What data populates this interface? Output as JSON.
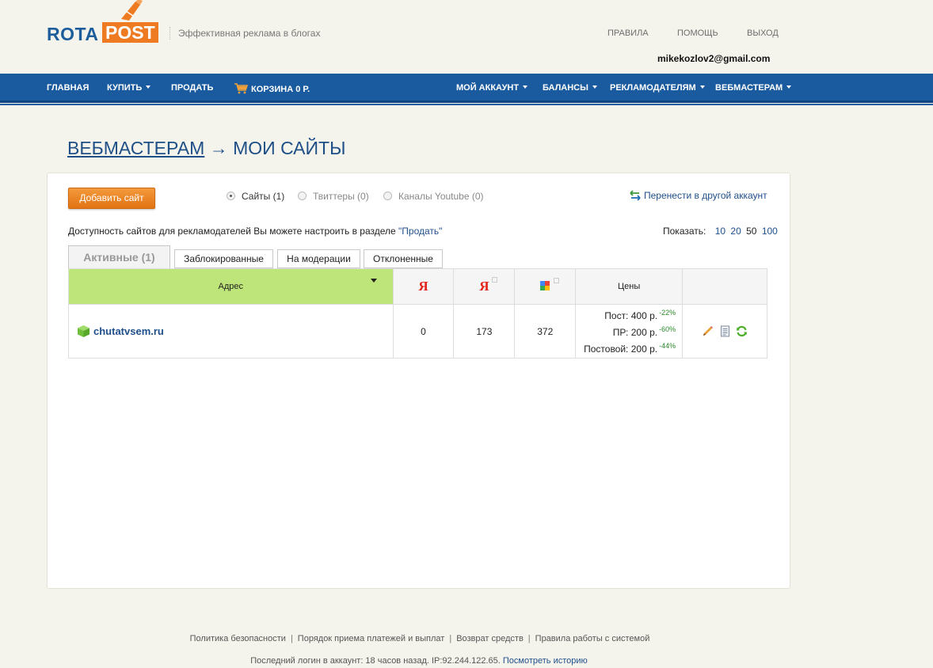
{
  "brand": {
    "part1": "ROTA",
    "part2": "POST",
    "tagline": "Эффективная реклама в блогах",
    "accent": "#ee7b22",
    "primary": "#1a5ba0"
  },
  "top_links": {
    "rules": "ПРАВИЛА",
    "help": "ПОМОЩЬ",
    "exit": "ВЫХОД"
  },
  "user": {
    "email": "mikekozlov2@gmail.com"
  },
  "nav": {
    "home": "ГЛАВНАЯ",
    "buy": "КУПИТЬ",
    "sell": "ПРОДАТЬ",
    "cart": "КОРЗИНА 0 Р.",
    "account": "МОЙ АККАУНТ",
    "balances": "БАЛАНСЫ",
    "advertisers": "РЕКЛАМОДАТЕЛЯМ",
    "webmasters": "ВЕБМАСТЕРАМ"
  },
  "breadcrumb": {
    "parent": "ВЕБМАСТЕРАМ",
    "arrow": "→",
    "current": "МОИ САЙТЫ"
  },
  "panel": {
    "add_button": "Добавить сайт",
    "radios": [
      {
        "label": "Сайты (1)",
        "checked": true
      },
      {
        "label": "Твиттеры (0)",
        "checked": false
      },
      {
        "label": "Каналы Youtube (0)",
        "checked": false
      }
    ],
    "transfer_link": "Перенести в другой аккаунт",
    "availability_text": "Доступность сайтов для рекламодателей Вы можете настроить в разделе",
    "availability_link": "\"Продать\"",
    "show_label": "Показать:",
    "page_sizes": [
      "10",
      "20",
      "50",
      "100"
    ],
    "page_size_current": "50"
  },
  "tabs": [
    "Активные (1)",
    "Заблокированные",
    "На модерации",
    "Отклоненные"
  ],
  "table": {
    "headers": {
      "address": "Адрес",
      "yandex1": "Я",
      "yandex2": "Я",
      "prices": "Цены"
    },
    "rows": [
      {
        "site": "chutatvsem.ru",
        "col1": "0",
        "col2": "173",
        "col3": "372",
        "prices": [
          {
            "label": "Пост: 400 р.",
            "discount": "-22%"
          },
          {
            "label": "ПР: 200 р.",
            "discount": "-60%"
          },
          {
            "label": "Постовой: 200 р.",
            "discount": "-44%"
          }
        ]
      }
    ]
  },
  "footer": {
    "links": [
      "Политика безопасности",
      "Порядок приема платежей и выплат",
      "Возврат средств",
      "Правила работы с системой"
    ],
    "separator": "|",
    "last_login": "Последний логин в аккаунт: 18 часов назад. IP:92.244.122.65.",
    "history_link": "Посмотреть историю"
  }
}
